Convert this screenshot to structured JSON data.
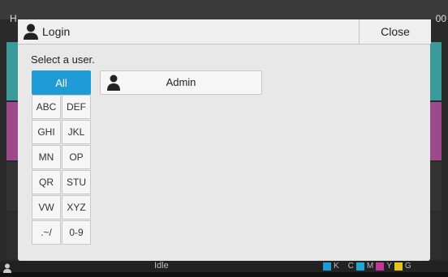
{
  "background": {
    "corner_left": "H",
    "corner_right": "00",
    "status": "Idle",
    "toner": [
      "K",
      "C",
      "M",
      "Y",
      "G"
    ]
  },
  "dialog": {
    "title": "Login",
    "close_label": "Close",
    "prompt": "Select a user.",
    "all_label": "All",
    "filters": [
      [
        "ABC",
        "DEF"
      ],
      [
        "GHI",
        "JKL"
      ],
      [
        "MN",
        "OP"
      ],
      [
        "QR",
        "STU"
      ],
      [
        "VW",
        "XYZ"
      ],
      [
        ".~/",
        "0-9"
      ]
    ],
    "users": [
      {
        "name": "Admin"
      }
    ]
  },
  "colors": {
    "accent": "#1f9bd6",
    "toner_k": "#1f9bd6",
    "toner_c": "#1fa8d6",
    "toner_m": "#c0399a",
    "toner_y": "#e6c21f",
    "toner_g": "#999999"
  }
}
